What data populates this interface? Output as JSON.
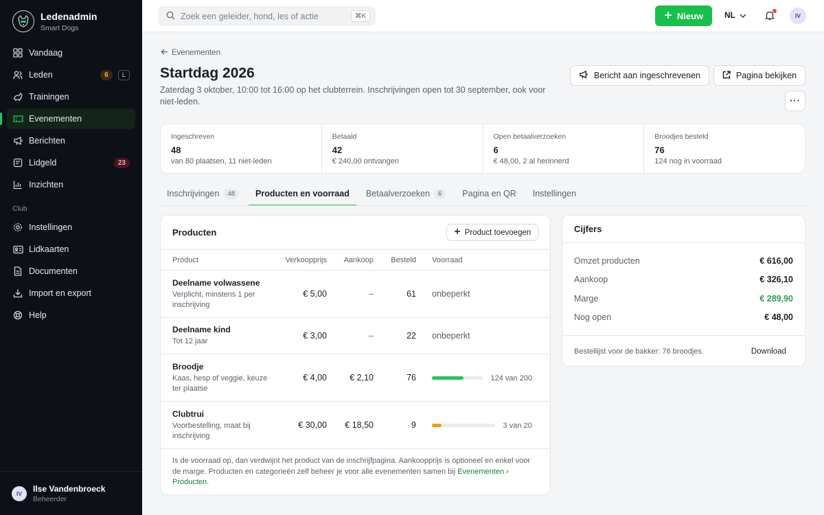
{
  "app": {
    "name": "Ledenadmin",
    "org": "Smart Dogs"
  },
  "sidebar": {
    "items": [
      {
        "label": "Vandaag"
      },
      {
        "label": "Leden",
        "badge": "6",
        "kbd": "L"
      },
      {
        "label": "Trainingen"
      },
      {
        "label": "Evenementen"
      },
      {
        "label": "Berichten"
      },
      {
        "label": "Lidgeld",
        "badge": "23"
      },
      {
        "label": "Inzichten"
      }
    ],
    "section_label": "Club",
    "club_items": [
      {
        "label": "Instellingen"
      },
      {
        "label": "Lidkaarten"
      },
      {
        "label": "Documenten"
      },
      {
        "label": "Import en export"
      },
      {
        "label": "Help"
      }
    ]
  },
  "user": {
    "initials": "IV",
    "name": "Ilse Vandenbroeck",
    "role": "Beheerder"
  },
  "topbar": {
    "search_placeholder": "Zoek een geleider, hond, les of actie",
    "search_shortcut": "⌘K",
    "new_label": "Nieuw",
    "language": "NL",
    "avatar_initials": "IV"
  },
  "page": {
    "breadcrumb": "Evenementen",
    "title": "Startdag 2026",
    "subtitle": "Zaterdag 3 oktober, 10:00 tot 16:00 op het clubterrein. Inschrijvingen open tot 30 september, ook voor niet-leden.",
    "actions": {
      "message": "Bericht aan ingeschrevenen",
      "view": "Pagina bekijken",
      "more": "···"
    }
  },
  "stats": [
    {
      "label": "Ingeschreven",
      "value": "48",
      "sub": "van 80 plaatsen, 11 niet-leden"
    },
    {
      "label": "Betaald",
      "value": "42",
      "sub": "€ 240,00 ontvangen"
    },
    {
      "label": "Open betaalverzoeken",
      "value": "6",
      "sub": "€ 48,00, 2 al herinnerd"
    },
    {
      "label": "Broodjes besteld",
      "value": "76",
      "sub": "124 nog in voorraad"
    }
  ],
  "tabs": [
    {
      "label": "Inschrijvingen",
      "count": "48"
    },
    {
      "label": "Producten en voorraad"
    },
    {
      "label": "Betaalverzoeken",
      "count": "6"
    },
    {
      "label": "Pagina en QR"
    },
    {
      "label": "Instellingen"
    }
  ],
  "products": {
    "title": "Producten",
    "add_label": "Product toevoegen",
    "columns": [
      "Product",
      "Verkoopprijs",
      "Aankoop",
      "Besteld",
      "Voorraad"
    ],
    "rows": [
      {
        "name": "Deelname volwassene",
        "desc": "Verplicht, minstens 1 per inschrijving",
        "price": "€ 5,00",
        "cost": "–",
        "ordered": "61",
        "stock": "onbeperkt"
      },
      {
        "name": "Deelname kind",
        "desc": "Tot 12 jaar",
        "price": "€ 3,00",
        "cost": "–",
        "ordered": "22",
        "stock": "onbeperkt"
      },
      {
        "name": "Broodje",
        "desc": "Kaas, hesp of veggie, keuze ter plaatse",
        "price": "€ 4,00",
        "cost": "€ 2,10",
        "ordered": "76",
        "stock": "124 van 200",
        "stock_fraction": 0.62,
        "bar_color": "#22c55e"
      },
      {
        "name": "Clubtrui",
        "desc": "Voorbestelling, maat bij inschrijving",
        "price": "€ 30,00",
        "cost": "€ 18,50",
        "ordered": "9",
        "stock": "3 van 20",
        "stock_fraction": 0.15,
        "bar_color": "#f59e0b"
      }
    ],
    "footnote": "Is de voorraad op, dan verdwijnt het product van de inschrijfpagina. Aankoopprijs is optioneel en enkel voor de marge. Producten en categorieën zelf beheer je voor alle evenementen samen bij ",
    "footnote_link": "Evenementen › Producten",
    "footnote_end": "."
  },
  "figures": {
    "title": "Cijfers",
    "rows": [
      {
        "label": "Omzet producten",
        "value": "€ 616,00"
      },
      {
        "label": "Aankoop",
        "value": "€ 326,10"
      },
      {
        "label": "Marge",
        "value": "€ 289,90",
        "color": "#2f9e4f"
      },
      {
        "label": "Nog open",
        "value": "€ 48,00"
      }
    ],
    "footer": "Bestellijst voor de bakker: 76 broodjes.",
    "download_label": "Download"
  },
  "colors": {
    "accent": "#22c55e",
    "sidebar_bg": "#0d1117"
  }
}
